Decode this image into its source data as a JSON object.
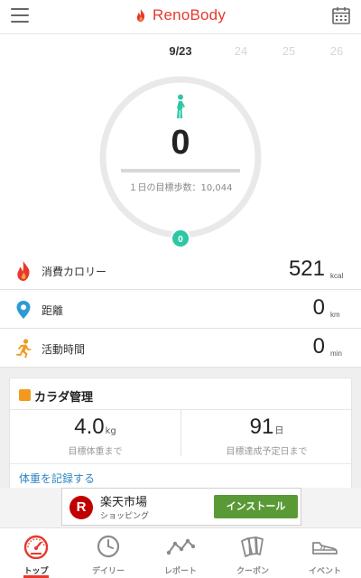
{
  "header": {
    "logo_text": "RenoBody",
    "menu_icon": "hamburger-menu-icon",
    "calendar_icon": "calendar-icon",
    "brand_color": "#e8382d"
  },
  "date_tabs": [
    {
      "label": "9/23",
      "active": true
    },
    {
      "label": "24",
      "active": false
    },
    {
      "label": "25",
      "active": false
    },
    {
      "label": "26",
      "active": false
    }
  ],
  "steps": {
    "value": "0",
    "goal_text": "１日の目標歩数：10,044",
    "progress_badge": "0",
    "progress_fraction": 0,
    "ring_color": "#e9e9e9",
    "badge_color": "#2dc7a4",
    "walker_icon_color": "#2dc7a4"
  },
  "stats": [
    {
      "icon": "flame-icon",
      "label": "消費カロリー",
      "value": "521",
      "unit": "kcal",
      "icon_color": "#e8382d"
    },
    {
      "icon": "location-pin-icon",
      "label": "距離",
      "value": "0",
      "unit": "km",
      "icon_color": "#2e9bd6"
    },
    {
      "icon": "running-person-icon",
      "label": "活動時間",
      "value": "0",
      "unit": "min",
      "icon_color": "#f39a1e"
    }
  ],
  "body_card": {
    "title": "カラダ管理",
    "weight_value": "4.0",
    "weight_unit": "kg",
    "weight_label": "目標体重まで",
    "days_value": "91",
    "days_unit": "日",
    "days_label": "目標達成予定日まで",
    "record_link": "体重を記録する"
  },
  "ad": {
    "logo_letter": "R",
    "title": "楽天市場",
    "subtitle": "ショッピング",
    "button": "インストール",
    "button_color": "#5a9a36"
  },
  "bottom_nav": [
    {
      "label": "トップ",
      "icon": "speedometer-icon",
      "active": true
    },
    {
      "label": "デイリー",
      "icon": "clock-icon",
      "active": false
    },
    {
      "label": "レポート",
      "icon": "line-chart-icon",
      "active": false
    },
    {
      "label": "クーポン",
      "icon": "coupon-tickets-icon",
      "active": false
    },
    {
      "label": "イベント",
      "icon": "sneaker-icon",
      "active": false
    }
  ]
}
